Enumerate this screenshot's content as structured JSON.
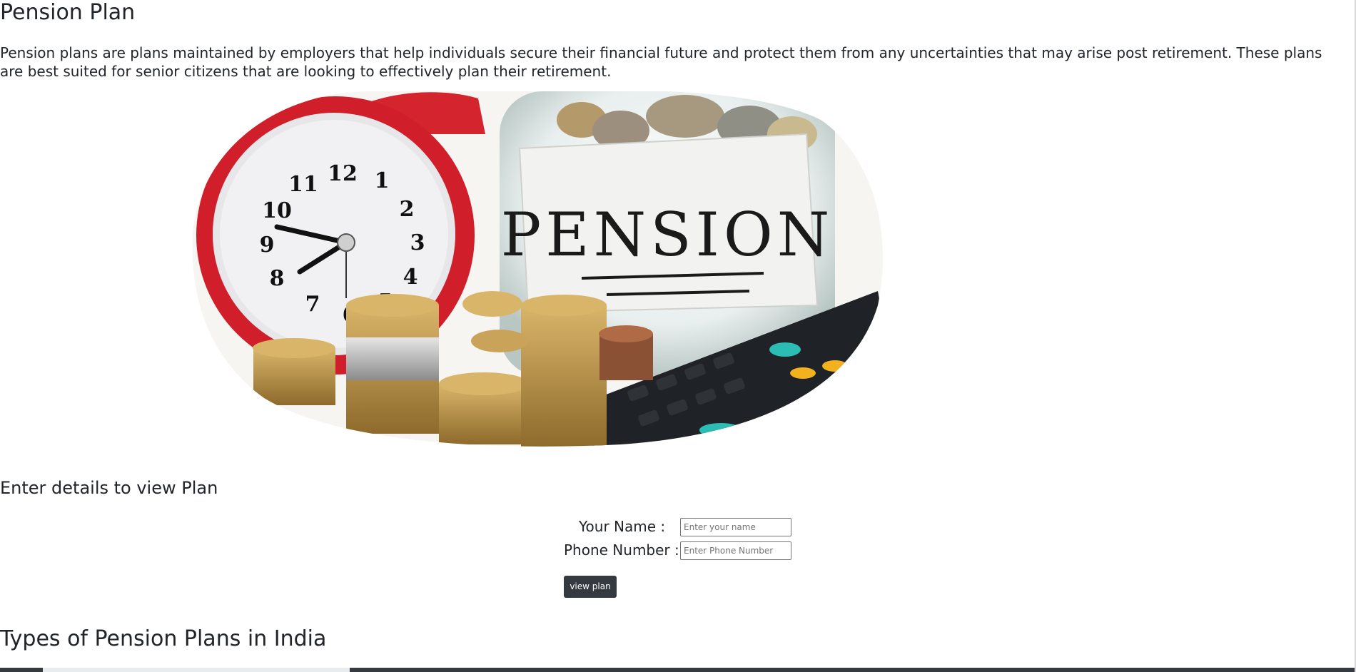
{
  "page": {
    "title": "Pension Plan",
    "intro": "Pension plans are plans maintained by employers that help individuals secure their financial future and protect them from any uncertainties that may arise post retirement. These plans are best suited for senior citizens that are looking to effectively plan their retirement."
  },
  "hero": {
    "label": "PENSION",
    "clock_numbers": [
      "12",
      "1",
      "2",
      "3",
      "4",
      "5",
      "6",
      "7",
      "8",
      "9",
      "10",
      "11"
    ]
  },
  "form": {
    "heading": "Enter details to view Plan",
    "name_label": "Your Name :",
    "name_placeholder": "Enter your name",
    "phone_label": "Phone Number :",
    "phone_placeholder": "Enter Phone Number",
    "button_label": "view plan"
  },
  "types": {
    "heading": "Types of Pension Plans in India"
  },
  "colors": {
    "button_bg": "#343a40",
    "text": "#212529"
  }
}
